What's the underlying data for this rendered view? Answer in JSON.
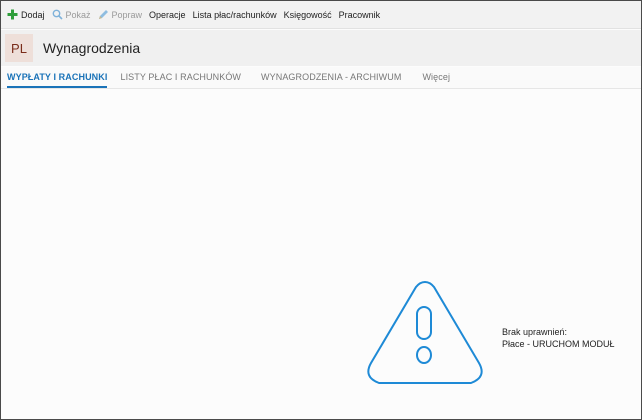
{
  "toolbar": {
    "items": [
      {
        "label": "Dodaj",
        "icon": "plus-icon"
      },
      {
        "label": "Pokaż",
        "icon": "magnifier-icon"
      },
      {
        "label": "Popraw",
        "icon": "pencil-icon"
      },
      {
        "label": "Operacje"
      },
      {
        "label": "Lista płac/rachunków"
      },
      {
        "label": "Księgowość"
      },
      {
        "label": "Pracownik"
      }
    ]
  },
  "header": {
    "badge": "PL",
    "title": "Wynagrodzenia"
  },
  "tabs": [
    {
      "label": "WYPŁATY I RACHUNKI",
      "active": true
    },
    {
      "label": "LISTY PŁAC I RACHUNKÓW"
    },
    {
      "label": "WYNAGRODZENIA - ARCHIWUM"
    },
    {
      "label": "Więcej"
    }
  ],
  "message": {
    "line1": "Brak uprawnień:",
    "line2": "Płace - URUCHOM MODUŁ"
  },
  "colors": {
    "accent": "#1a73b8",
    "warning_icon": "#1e8ad6",
    "add_icon": "#2e9d3a",
    "badge_bg": "#eedfd9"
  }
}
